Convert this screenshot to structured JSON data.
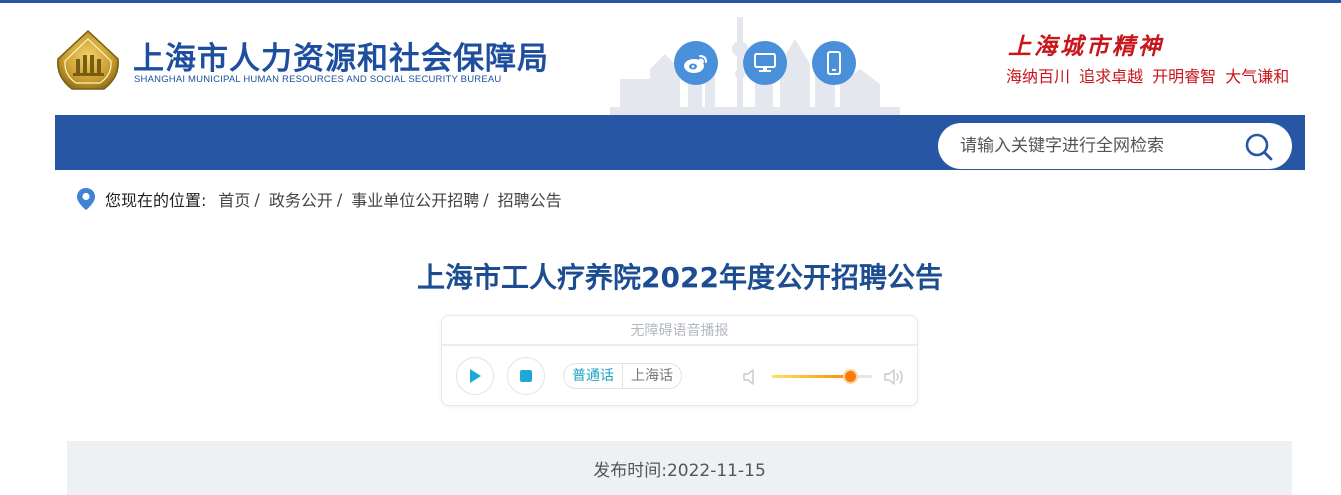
{
  "header": {
    "org_name": "上海市人力资源和社会保障局",
    "org_name_en": "SHANGHAI MUNICIPAL HUMAN RESOURCES AND SOCIAL SECURITY BUREAU",
    "social_icons": [
      "weibo-icon",
      "desktop-icon",
      "mobile-icon"
    ],
    "spirit_title": "上海城市精神",
    "spirit_words": "海纳百川  追求卓越  开明睿智  大气谦和"
  },
  "search": {
    "placeholder": "请输入关键字进行全网检索",
    "icon": "search-icon"
  },
  "breadcrumb": {
    "label": "您现在的位置:",
    "items": [
      "首页",
      "政务公开",
      "事业单位公开招聘",
      "招聘公告"
    ],
    "separator": "/"
  },
  "article": {
    "title": "上海市工人疗养院2022年度公开招聘公告"
  },
  "player": {
    "header": "无障碍语音播报",
    "languages": [
      "普通话",
      "上海话"
    ],
    "selected_language": "普通话",
    "volume": 0.78
  },
  "meta": {
    "publish": "发布时间:2022-11-15"
  },
  "colors": {
    "brand_blue": "#2756a5",
    "title_blue": "#1c4d91",
    "spirit_red": "#c8161d",
    "icon_blue": "#4a8fd9"
  }
}
